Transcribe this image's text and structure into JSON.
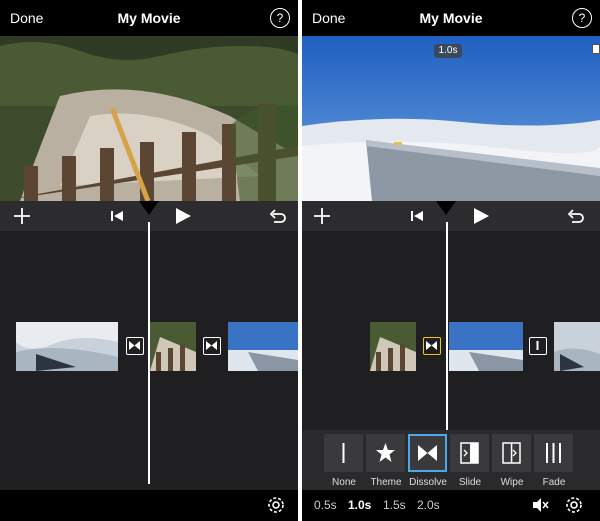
{
  "left": {
    "nav": {
      "done": "Done",
      "title": "My Movie",
      "help": "?"
    }
  },
  "right": {
    "nav": {
      "done": "Done",
      "title": "My Movie",
      "help": "?"
    },
    "badge": "1.0s",
    "transitions": [
      {
        "label": "None",
        "icon": "none-icon"
      },
      {
        "label": "Theme",
        "icon": "star-icon"
      },
      {
        "label": "Dissolve",
        "icon": "dissolve-icon",
        "selected": true
      },
      {
        "label": "Slide",
        "icon": "slide-icon"
      },
      {
        "label": "Wipe",
        "icon": "wipe-icon"
      },
      {
        "label": "Fade",
        "icon": "fade-icon"
      }
    ],
    "durations": [
      "0.5s",
      "1.0s",
      "1.5s",
      "2.0s"
    ],
    "selected_duration": "1.0s"
  },
  "colors": {
    "accent_selected": "#4aa9e8",
    "transition_selected": "#f5c518"
  }
}
